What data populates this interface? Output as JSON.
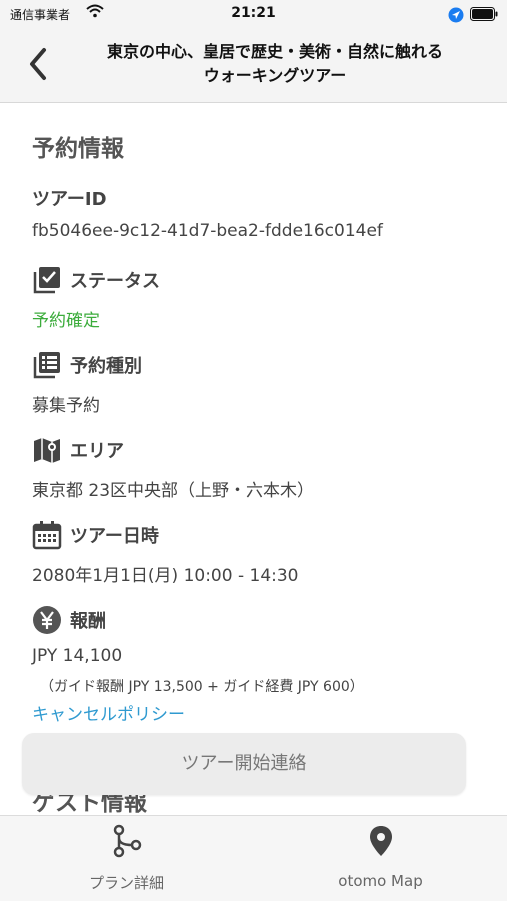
{
  "status_bar": {
    "carrier": "通信事業者",
    "time": "21:21"
  },
  "nav": {
    "title_line1": "東京の中心、皇居で歴史・美術・自然に触れる",
    "title_line2": "ウォーキングツアー"
  },
  "reservation": {
    "section_title": "予約情報",
    "tour_id_label": "ツアーID",
    "tour_id_value": "fb5046ee-9c12-41d7-bea2-fdde16c014ef",
    "status_label": "ステータス",
    "status_value": "予約確定",
    "type_label": "予約種別",
    "type_value": "募集予約",
    "area_label": "エリア",
    "area_value": "東京都 23区中央部（上野・六本木）",
    "datetime_label": "ツアー日時",
    "datetime_value": "2080年1月1日(月) 10:00 - 14:30",
    "fee_label": "報酬",
    "fee_value": "JPY 14,100",
    "fee_breakdown": "（ガイド報酬 JPY 13,500 + ガイド経費 JPY 600）",
    "cancel_policy_link": "キャンセルポリシー"
  },
  "next_section_cut": "ゲスト情報",
  "start_button_label": "ツアー開始連絡",
  "tabs": [
    {
      "label": "プラン詳細",
      "icon": "route-icon"
    },
    {
      "label": "otomo Map",
      "icon": "map-pin-icon"
    }
  ],
  "colors": {
    "status_green": "#3cac3c",
    "link_blue": "#2f9ad0",
    "location_blue": "#1a7cf0"
  }
}
